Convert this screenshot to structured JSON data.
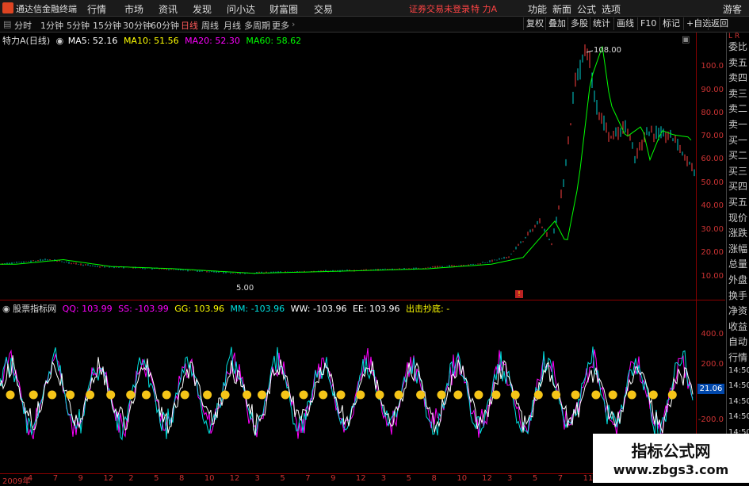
{
  "menu": {
    "app_title": "通达信金融终端",
    "items": [
      "行情",
      "市场",
      "资讯",
      "发现",
      "问小达",
      "财富圈",
      "交易"
    ],
    "warning": "证券交易未登录",
    "stock_name": "特 力A",
    "right_items": [
      "功能",
      "新面",
      "公式",
      "选项",
      "游客"
    ]
  },
  "toolbar": {
    "periods": [
      "分时",
      "1分钟",
      "5分钟",
      "15分钟",
      "30分钟",
      "60分钟",
      "日线",
      "周线",
      "月线",
      "多周期",
      "更多"
    ],
    "active_period": "日线",
    "right_buttons": [
      "复权",
      "叠加",
      "多股",
      "统计",
      "画线",
      "F10",
      "标记",
      "+自选",
      "返回"
    ]
  },
  "main_legend": {
    "stock": "特力A(日线)",
    "ma5": "MA5: 52.16",
    "ma10": "MA10: 51.56",
    "ma20": "MA20: 52.30",
    "ma60": "MA60: 58.62"
  },
  "main_annotations": {
    "high": "108.00",
    "low": "5.00"
  },
  "main_axis_labels": [
    "100.0",
    "90.00",
    "80.00",
    "70.00",
    "60.00",
    "50.00",
    "40.00",
    "30.00",
    "20.00",
    "10.00"
  ],
  "sub_legend": {
    "name": "股票指标网",
    "qq": "QQ: 103.99",
    "ss": "SS: -103.99",
    "gg": "GG: 103.96",
    "mm": "MM: -103.96",
    "ww": "WW: -103.96",
    "ee": "EE: 103.96",
    "signal": "出击抄底: -"
  },
  "sub_axis_labels": [
    "400.0",
    "200.0",
    "-200.0"
  ],
  "sub_axis_value": "21.06",
  "side_panel": {
    "top_letters": "L R",
    "items": [
      "委比",
      "卖五",
      "卖四",
      "卖三",
      "卖二",
      "卖一",
      "买一",
      "买二",
      "买三",
      "买四",
      "买五",
      "现价",
      "涨跌",
      "涨幅",
      "总量",
      "外盘",
      "换手",
      "净资",
      "收益",
      "自动",
      "行情",
      "14:50",
      "14:50",
      "14:50",
      "14:50",
      "14:50",
      "14:50",
      "14:50",
      "14:50"
    ]
  },
  "date_axis": [
    "2009年",
    "4",
    "7",
    "9",
    "12",
    "2",
    "5",
    "8",
    "10",
    "12",
    "3",
    "5",
    "7",
    "9",
    "12",
    "3",
    "5",
    "8",
    "10",
    "12",
    "3",
    "5",
    "7",
    "11",
    "1",
    "4",
    "7",
    "9"
  ],
  "watermark": {
    "line1": "指标公式网",
    "line2": "www.zbgs3.com"
  },
  "colors": {
    "up": "#ff4040",
    "down": "#00d0d0",
    "ma5": "#ffffff",
    "ma10": "#ffff00",
    "ma20": "#ff00ff",
    "ma60": "#00ff00",
    "axis": "#8b0000"
  }
}
